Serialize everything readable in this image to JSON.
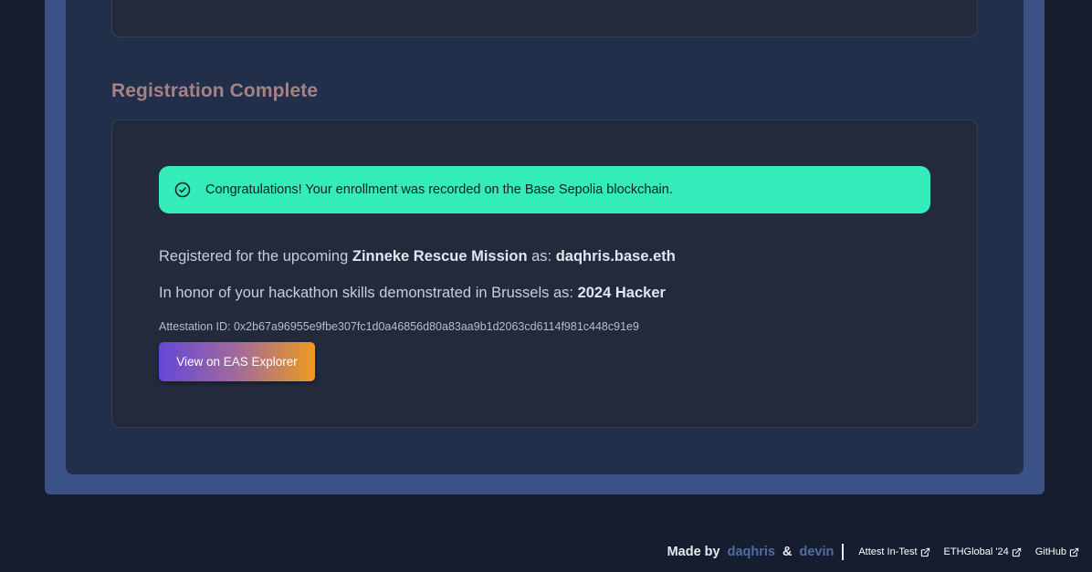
{
  "section_title": "Registration Complete",
  "alert": {
    "message": "Congratulations! Your enrollment was recorded on the Base Sepolia blockchain.",
    "icon": "check-circle-icon",
    "color": "#33ecba"
  },
  "registration": {
    "prefix": "Registered for the upcoming ",
    "mission": "Zinneke Rescue Mission",
    "as": " as: ",
    "name": "daqhris.base.eth"
  },
  "honor": {
    "prefix": "In honor of your hackathon skills demonstrated in Brussels as: ",
    "role": "2024 Hacker"
  },
  "attestation": {
    "label": "Attestation ID: ",
    "id": "0x2b67a96955e9fbe307fc1d0a46856d80a83aa9b1d2063cd6114f981c448c91e9"
  },
  "eas_button_label": "View on EAS Explorer",
  "footer": {
    "made_by": "Made by",
    "author1": "daqhris",
    "amp": "&",
    "author2": "devin",
    "links": [
      {
        "label": "Attest In-Test",
        "icon": "external-link-icon"
      },
      {
        "label": "ETHGlobal '24",
        "icon": "external-link-icon"
      },
      {
        "label": "GitHub",
        "icon": "external-link-icon"
      }
    ]
  }
}
